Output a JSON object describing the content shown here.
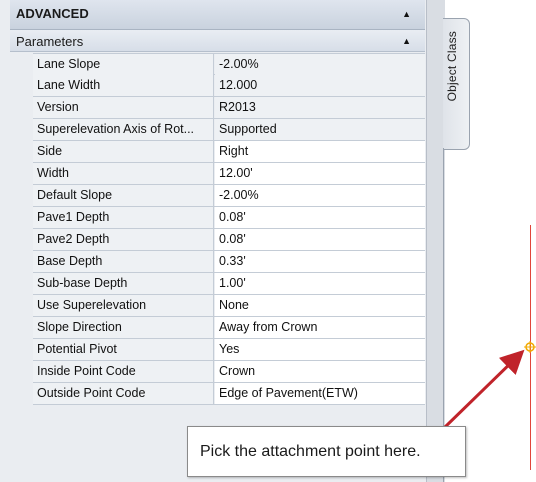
{
  "panel": {
    "section_title": "ADVANCED",
    "section_toggle": "▲",
    "group_title": "Parameters",
    "group_toggle": "▲",
    "properties": [
      {
        "name": "Lane Slope",
        "value": "-2.00%"
      },
      {
        "name": "Lane Width",
        "value": "12.000"
      },
      {
        "name": "Version",
        "value": "R2013"
      },
      {
        "name": "Superelevation Axis of Rot...",
        "value": "Supported"
      },
      {
        "name": "Side",
        "value": "Right"
      },
      {
        "name": "Width",
        "value": "12.00'"
      },
      {
        "name": "Default Slope",
        "value": "-2.00%"
      },
      {
        "name": "Pave1 Depth",
        "value": "0.08'"
      },
      {
        "name": "Pave2 Depth",
        "value": "0.08'"
      },
      {
        "name": "Base Depth",
        "value": "0.33'"
      },
      {
        "name": "Sub-base Depth",
        "value": "1.00'"
      },
      {
        "name": "Use Superelevation",
        "value": "None"
      },
      {
        "name": "Slope Direction",
        "value": "Away from Crown"
      },
      {
        "name": "Potential Pivot",
        "value": "Yes"
      },
      {
        "name": "Inside Point Code",
        "value": "Crown"
      },
      {
        "name": "Outside Point Code",
        "value": "Edge of Pavement(ETW)"
      }
    ]
  },
  "side_tab": {
    "label": "Object Class"
  },
  "callout": {
    "text": "Pick the attachment point here."
  },
  "colors": {
    "arrow": "#c0232a",
    "marker": "#f2a900",
    "drawing_line": "#e0453a"
  }
}
